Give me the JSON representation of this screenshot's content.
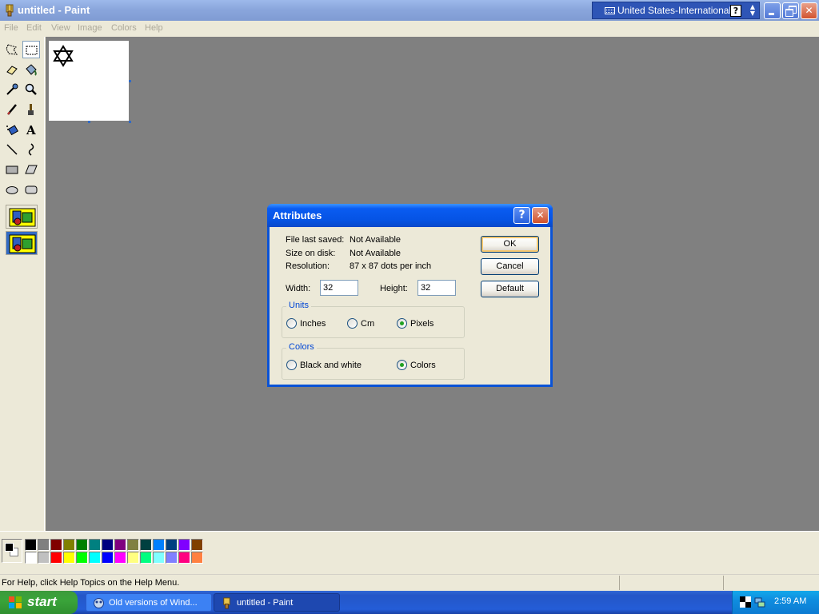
{
  "window": {
    "title": "untitled - Paint",
    "language": "United States-International",
    "language_help": "?"
  },
  "menu": [
    "File",
    "Edit",
    "View",
    "Image",
    "Colors",
    "Help"
  ],
  "toolbox": {
    "tools": [
      "free-form-select",
      "select",
      "eraser",
      "fill-with-color",
      "pick-color",
      "magnifier",
      "pencil",
      "brush",
      "airbrush",
      "text",
      "line",
      "curve",
      "rectangle",
      "polygon",
      "ellipse",
      "rounded-rectangle"
    ],
    "selected_tool": "select",
    "text_tool_glyph": "A"
  },
  "canvas": {
    "drawing": "star-of-david"
  },
  "palette": {
    "foreground": "#000000",
    "background": "#ffffff",
    "row1": [
      "#000000",
      "#808080",
      "#800000",
      "#808000",
      "#008000",
      "#008080",
      "#000080",
      "#800080",
      "#808040",
      "#004040",
      "#0080ff",
      "#004080",
      "#8000ff",
      "#804000"
    ],
    "row2": [
      "#ffffff",
      "#c0c0c0",
      "#ff0000",
      "#ffff00",
      "#00ff00",
      "#00ffff",
      "#0000ff",
      "#ff00ff",
      "#ffff80",
      "#00ff80",
      "#80ffff",
      "#8080ff",
      "#ff0080",
      "#ff8040"
    ]
  },
  "status": {
    "text": "For Help, click Help Topics on the Help Menu."
  },
  "taskbar": {
    "start": "start",
    "tasks": [
      {
        "label": "Old versions of Wind...",
        "active": false
      },
      {
        "label": "untitled - Paint",
        "active": true
      }
    ],
    "clock": "2:59 AM"
  },
  "dialog": {
    "title": "Attributes",
    "help": "?",
    "file_last_saved_label": "File last saved:",
    "file_last_saved_value": "Not Available",
    "size_on_disk_label": "Size on disk:",
    "size_on_disk_value": "Not Available",
    "resolution_label": "Resolution:",
    "resolution_value": "87 x 87 dots per inch",
    "width_label": "Width:",
    "width_value": "32",
    "height_label": "Height:",
    "height_value": "32",
    "units": {
      "title": "Units",
      "options": [
        "Inches",
        "Cm",
        "Pixels"
      ],
      "selected": "Pixels"
    },
    "colors": {
      "title": "Colors",
      "options": [
        "Black and white",
        "Colors"
      ],
      "selected": "Colors"
    },
    "ok": "OK",
    "cancel": "Cancel",
    "default": "Default"
  }
}
